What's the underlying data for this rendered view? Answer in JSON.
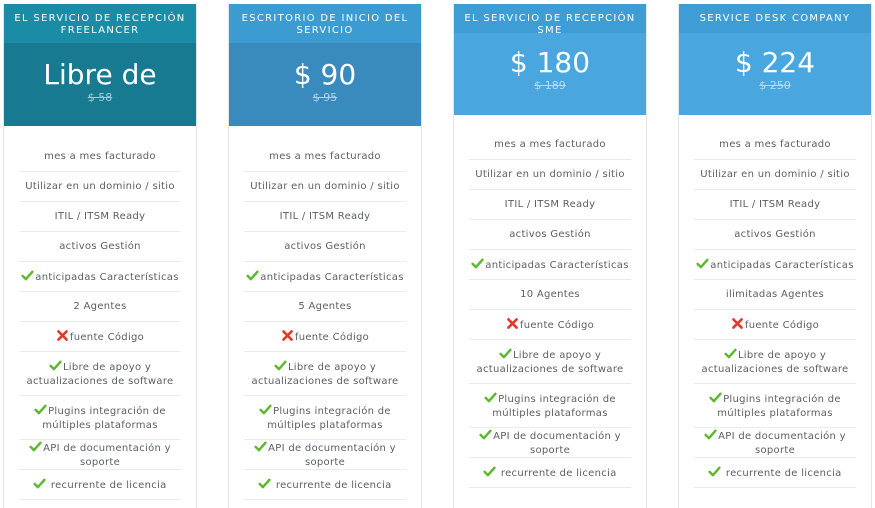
{
  "plans": [
    {
      "title": "EL SERVICIO DE RECEPCIÓN FREELANCER",
      "price": "Libre de",
      "old_price": "$ 58",
      "features": [
        {
          "icon": "",
          "text": "mes a mes facturado"
        },
        {
          "icon": "",
          "text": "Utilizar  en un dominio / sitio"
        },
        {
          "icon": "",
          "text": "ITIL / ITSM Ready"
        },
        {
          "icon": "",
          "text": "activos Gestión"
        },
        {
          "icon": "check-icon",
          "text": "anticipadas Características"
        },
        {
          "icon": "",
          "text": "2 Agentes"
        },
        {
          "icon": "cross-icon",
          "text": "fuente Código"
        },
        {
          "icon": "check-icon",
          "text": "Libre de apoyo y actualizaciones de software"
        },
        {
          "icon": "check-icon",
          "text": "Plugins integración de múltiples plataformas"
        },
        {
          "icon": "check-icon",
          "text": "API de documentación y soporte"
        },
        {
          "icon": "check-icon",
          "text": " recurrente de licencia"
        }
      ]
    },
    {
      "title": "ESCRITORIO DE INICIO DEL SERVICIO",
      "price": "$ 90",
      "old_price": "$ 95",
      "features": [
        {
          "icon": "",
          "text": "mes a mes facturado"
        },
        {
          "icon": "",
          "text": "Utilizar  en un dominio / sitio"
        },
        {
          "icon": "",
          "text": "ITIL / ITSM Ready"
        },
        {
          "icon": "",
          "text": "activos Gestión"
        },
        {
          "icon": "check-icon",
          "text": "anticipadas Características"
        },
        {
          "icon": "",
          "text": "5 Agentes"
        },
        {
          "icon": "cross-icon",
          "text": "fuente Código"
        },
        {
          "icon": "check-icon",
          "text": "Libre de apoyo y actualizaciones de software"
        },
        {
          "icon": "check-icon",
          "text": "Plugins integración de múltiples plataformas"
        },
        {
          "icon": "check-icon",
          "text": "API de documentación y soporte"
        },
        {
          "icon": "check-icon",
          "text": " recurrente de licencia"
        }
      ]
    },
    {
      "title": "EL SERVICIO DE RECEPCIÓN SME",
      "price": "$ 180",
      "old_price": "$ 189",
      "features": [
        {
          "icon": "",
          "text": "mes a mes facturado"
        },
        {
          "icon": "",
          "text": "Utilizar  en un dominio / sitio"
        },
        {
          "icon": "",
          "text": "ITIL / ITSM Ready"
        },
        {
          "icon": "",
          "text": "activos Gestión"
        },
        {
          "icon": "check-icon",
          "text": "anticipadas Características"
        },
        {
          "icon": "",
          "text": "10  Agentes"
        },
        {
          "icon": "cross-icon",
          "text": "fuente Código"
        },
        {
          "icon": "check-icon",
          "text": "Libre de apoyo y actualizaciones de software"
        },
        {
          "icon": "check-icon",
          "text": "Plugins integración de múltiples plataformas"
        },
        {
          "icon": "check-icon",
          "text": "API de documentación y soporte"
        },
        {
          "icon": "check-icon",
          "text": " recurrente de licencia"
        }
      ]
    },
    {
      "title": "SERVICE DESK COMPANY",
      "price": "$ 224",
      "old_price": "$ 250",
      "features": [
        {
          "icon": "",
          "text": "mes a mes facturado"
        },
        {
          "icon": "",
          "text": "Utilizar  en un dominio / sitio"
        },
        {
          "icon": "",
          "text": "ITIL / ITSM Ready"
        },
        {
          "icon": "",
          "text": "activos Gestión"
        },
        {
          "icon": "check-icon",
          "text": "anticipadas Características"
        },
        {
          "icon": "",
          "text": "ilimitadas  Agentes"
        },
        {
          "icon": "cross-icon",
          "text": "fuente Código"
        },
        {
          "icon": "check-icon",
          "text": "Libre de apoyo y actualizaciones de software"
        },
        {
          "icon": "check-icon",
          "text": "Plugins integración de múltiples plataformas"
        },
        {
          "icon": "check-icon",
          "text": "API de documentación y soporte"
        },
        {
          "icon": "check-icon",
          "text": " recurrente de licencia"
        }
      ]
    }
  ],
  "colors": {
    "check": "#5cb82e",
    "cross": "#e03a2f"
  }
}
